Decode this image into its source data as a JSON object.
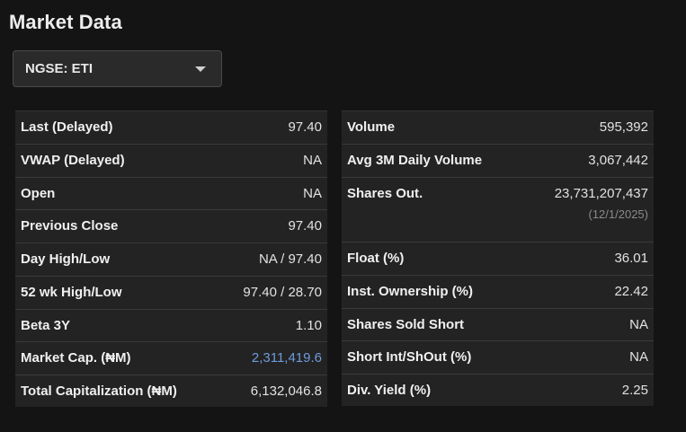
{
  "title": "Market Data",
  "ticker_select": {
    "value": "NGSE: ETI"
  },
  "left_table": [
    {
      "label": "Last (Delayed)",
      "value": "97.40"
    },
    {
      "label": "VWAP (Delayed)",
      "value": "NA"
    },
    {
      "label": "Open",
      "value": "NA"
    },
    {
      "label": "Previous Close",
      "value": "97.40"
    },
    {
      "label": "Day High/Low",
      "value": "NA / 97.40"
    },
    {
      "label": "52 wk High/Low",
      "value": "97.40 / 28.70"
    },
    {
      "label": "Beta 3Y",
      "value": "1.10"
    },
    {
      "label": "Market Cap. (₦M)",
      "value": "2,311,419.6"
    },
    {
      "label": "Total Capitalization (₦M)",
      "value": "6,132,046.8"
    }
  ],
  "right_table": [
    {
      "label": "Volume",
      "value": "595,392"
    },
    {
      "label": "Avg 3M Daily Volume",
      "value": "3,067,442"
    },
    {
      "label": "Shares Out.",
      "value": "23,731,207,437",
      "sub": "(12/1/2025)"
    },
    {
      "label": "Float (%)",
      "value": "36.01"
    },
    {
      "label": "Inst. Ownership (%)",
      "value": "22.42"
    },
    {
      "label": "Shares Sold Short",
      "value": "NA"
    },
    {
      "label": "Short Int/ShOut (%)",
      "value": "NA"
    },
    {
      "label": "Div. Yield (%)",
      "value": "2.25"
    }
  ],
  "colors": {
    "link": "#6e9bdc",
    "background": "#141414",
    "row": "#232323"
  }
}
